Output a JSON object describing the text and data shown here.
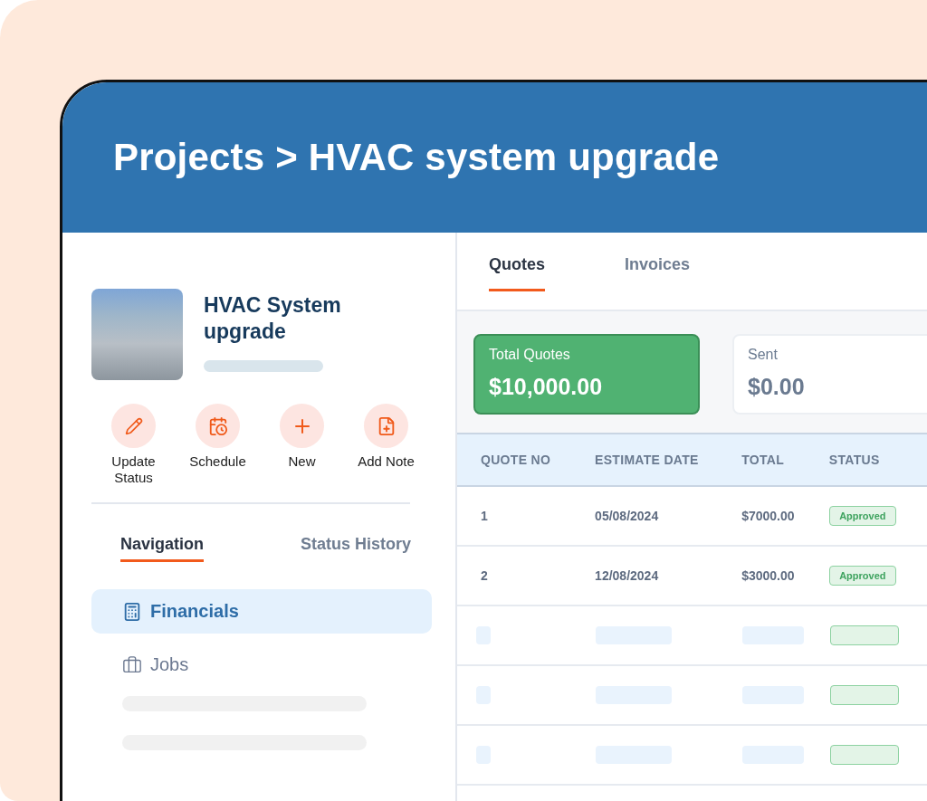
{
  "header": {
    "title": "Projects > HVAC system upgrade"
  },
  "project": {
    "name": "HVAC System upgrade"
  },
  "actions": [
    {
      "kind": "edit",
      "label": "Update Status"
    },
    {
      "kind": "schedule",
      "label": "Schedule"
    },
    {
      "kind": "add",
      "label": "New"
    },
    {
      "kind": "note",
      "label": "Add Note"
    }
  ],
  "side_tabs": [
    {
      "label": "Navigation",
      "selected": true
    },
    {
      "label": "Status History",
      "selected": false
    }
  ],
  "nav_items": [
    {
      "kind": "link",
      "label": "Financials",
      "selected": true
    },
    {
      "kind": "link",
      "label": "Jobs",
      "selected": false
    },
    {
      "kind": "placeholder"
    },
    {
      "kind": "placeholder"
    }
  ],
  "main_tabs": [
    {
      "label": "Quotes",
      "selected": true
    },
    {
      "label": "Invoices",
      "selected": false
    }
  ],
  "summary_cards": [
    {
      "label": "Total Quotes",
      "value": "$10,000.00",
      "highlighted": true
    },
    {
      "label": "Sent",
      "value": "$0.00",
      "highlighted": false
    }
  ],
  "table": {
    "columns": [
      "QUOTE NO",
      "ESTIMATE DATE",
      "TOTAL",
      "STATUS"
    ],
    "rows": [
      {
        "kind": "data",
        "quote_no": "1",
        "estimate_date": "05/08/2024",
        "total": "$7000.00",
        "status": "Approved"
      },
      {
        "kind": "data",
        "quote_no": "2",
        "estimate_date": "12/08/2024",
        "total": "$3000.00",
        "status": "Approved"
      },
      {
        "kind": "placeholder"
      },
      {
        "kind": "placeholder"
      },
      {
        "kind": "placeholder"
      }
    ]
  }
}
